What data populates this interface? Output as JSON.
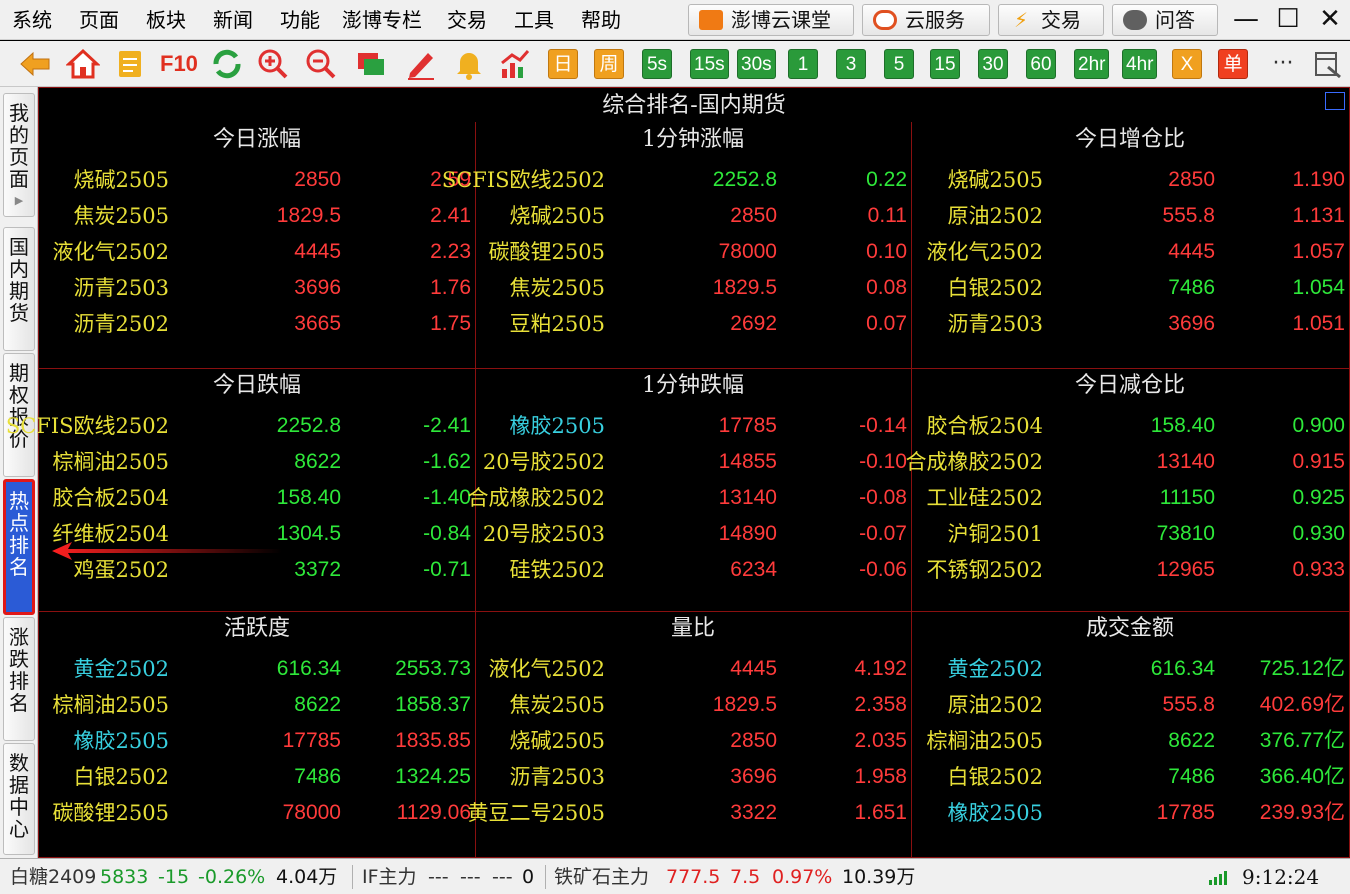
{
  "menu": [
    "系统",
    "页面",
    "板块",
    "新闻",
    "功能",
    "澎博专栏",
    "交易",
    "工具",
    "帮助"
  ],
  "top_buttons": [
    {
      "label": "澎博云课堂",
      "icon": "classroom-icon",
      "color": "#f07a14"
    },
    {
      "label": "云服务",
      "icon": "cloud-icon",
      "color": "#e05020"
    },
    {
      "label": "交易",
      "icon": "lightning-icon",
      "color": "#f0a010"
    },
    {
      "label": "问答",
      "icon": "chat-bubble-icon",
      "color": "#606060"
    }
  ],
  "window_controls": {
    "minimize": "—",
    "maximize": "☐",
    "close": "✕"
  },
  "toolbar": {
    "icons": [
      "back-arrow-icon",
      "home-icon",
      "notes-icon",
      "f10-icon",
      "refresh-icon",
      "zoom-in-icon",
      "zoom-out-icon",
      "window-icon",
      "pen-icon",
      "bell-icon",
      "chart-up-icon"
    ],
    "f10_label": "F10",
    "timeframes": [
      {
        "label": "日",
        "style": "orange"
      },
      {
        "label": "周",
        "style": "orange"
      },
      {
        "label": "5s",
        "style": "green"
      },
      {
        "label": "15s",
        "style": "green"
      },
      {
        "label": "30s",
        "style": "green"
      },
      {
        "label": "1",
        "style": "green"
      },
      {
        "label": "3",
        "style": "green"
      },
      {
        "label": "5",
        "style": "green"
      },
      {
        "label": "15",
        "style": "green"
      },
      {
        "label": "30",
        "style": "green"
      },
      {
        "label": "60",
        "style": "green"
      },
      {
        "label": "2hr",
        "style": "green"
      },
      {
        "label": "4hr",
        "style": "green"
      },
      {
        "label": "X",
        "style": "orange"
      },
      {
        "label": "单",
        "style": "red"
      }
    ],
    "more": "···"
  },
  "side_tabs": [
    {
      "label": "我的页面",
      "active": false,
      "has_arrow": true
    },
    {
      "label": "国内期货",
      "active": false,
      "has_arrow": false
    },
    {
      "label": "期权报价",
      "active": false,
      "has_arrow": false
    },
    {
      "label": "热点排名",
      "active": true,
      "has_arrow": false
    },
    {
      "label": "涨跌排名",
      "active": false,
      "has_arrow": false
    },
    {
      "label": "数据中心",
      "active": false,
      "has_arrow": false
    }
  ],
  "main_title": "综合排名-国内期货",
  "panels": [
    {
      "title": "今日涨幅",
      "rows": [
        {
          "name": "烧碱2505",
          "nc": "yellow",
          "price": "2850",
          "pc": "red",
          "value": "2.59",
          "vc": "red"
        },
        {
          "name": "焦炭2505",
          "nc": "yellow",
          "price": "1829.5",
          "pc": "red",
          "value": "2.41",
          "vc": "red"
        },
        {
          "name": "液化气2502",
          "nc": "yellow",
          "price": "4445",
          "pc": "red",
          "value": "2.23",
          "vc": "red"
        },
        {
          "name": "沥青2503",
          "nc": "yellow",
          "price": "3696",
          "pc": "red",
          "value": "1.76",
          "vc": "red"
        },
        {
          "name": "沥青2502",
          "nc": "yellow",
          "price": "3665",
          "pc": "red",
          "value": "1.75",
          "vc": "red"
        }
      ]
    },
    {
      "title": "1分钟涨幅",
      "rows": [
        {
          "name": "SCFIS欧线2502",
          "nc": "yellow",
          "price": "2252.8",
          "pc": "green",
          "value": "0.22",
          "vc": "green"
        },
        {
          "name": "烧碱2505",
          "nc": "yellow",
          "price": "2850",
          "pc": "red",
          "value": "0.11",
          "vc": "red"
        },
        {
          "name": "碳酸锂2505",
          "nc": "yellow",
          "price": "78000",
          "pc": "red",
          "value": "0.10",
          "vc": "red"
        },
        {
          "name": "焦炭2505",
          "nc": "yellow",
          "price": "1829.5",
          "pc": "red",
          "value": "0.08",
          "vc": "red"
        },
        {
          "name": "豆粕2505",
          "nc": "yellow",
          "price": "2692",
          "pc": "red",
          "value": "0.07",
          "vc": "red"
        }
      ]
    },
    {
      "title": "今日增仓比",
      "rows": [
        {
          "name": "烧碱2505",
          "nc": "yellow",
          "price": "2850",
          "pc": "red",
          "value": "1.190",
          "vc": "red"
        },
        {
          "name": "原油2502",
          "nc": "yellow",
          "price": "555.8",
          "pc": "red",
          "value": "1.131",
          "vc": "red"
        },
        {
          "name": "液化气2502",
          "nc": "yellow",
          "price": "4445",
          "pc": "red",
          "value": "1.057",
          "vc": "red"
        },
        {
          "name": "白银2502",
          "nc": "yellow",
          "price": "7486",
          "pc": "green",
          "value": "1.054",
          "vc": "green"
        },
        {
          "name": "沥青2503",
          "nc": "yellow",
          "price": "3696",
          "pc": "red",
          "value": "1.051",
          "vc": "red"
        }
      ]
    },
    {
      "title": "今日跌幅",
      "rows": [
        {
          "name": "SCFIS欧线2502",
          "nc": "yellow",
          "price": "2252.8",
          "pc": "green",
          "value": "-2.41",
          "vc": "green"
        },
        {
          "name": "棕榈油2505",
          "nc": "yellow",
          "price": "8622",
          "pc": "green",
          "value": "-1.62",
          "vc": "green"
        },
        {
          "name": "胶合板2504",
          "nc": "yellow",
          "price": "158.40",
          "pc": "green",
          "value": "-1.40",
          "vc": "green"
        },
        {
          "name": "纤维板2504",
          "nc": "yellow",
          "price": "1304.5",
          "pc": "green",
          "value": "-0.84",
          "vc": "green"
        },
        {
          "name": "鸡蛋2502",
          "nc": "yellow",
          "price": "3372",
          "pc": "green",
          "value": "-0.71",
          "vc": "green"
        }
      ]
    },
    {
      "title": "1分钟跌幅",
      "rows": [
        {
          "name": "橡胶2505",
          "nc": "cyan",
          "price": "17785",
          "pc": "red",
          "value": "-0.14",
          "vc": "red"
        },
        {
          "name": "20号胶2502",
          "nc": "yellow",
          "price": "14855",
          "pc": "red",
          "value": "-0.10",
          "vc": "red"
        },
        {
          "name": "合成橡胶2502",
          "nc": "yellow",
          "price": "13140",
          "pc": "red",
          "value": "-0.08",
          "vc": "red"
        },
        {
          "name": "20号胶2503",
          "nc": "yellow",
          "price": "14890",
          "pc": "red",
          "value": "-0.07",
          "vc": "red"
        },
        {
          "name": "硅铁2502",
          "nc": "yellow",
          "price": "6234",
          "pc": "red",
          "value": "-0.06",
          "vc": "red"
        }
      ]
    },
    {
      "title": "今日减仓比",
      "rows": [
        {
          "name": "胶合板2504",
          "nc": "yellow",
          "price": "158.40",
          "pc": "green",
          "value": "0.900",
          "vc": "green"
        },
        {
          "name": "合成橡胶2502",
          "nc": "yellow",
          "price": "13140",
          "pc": "red",
          "value": "0.915",
          "vc": "red"
        },
        {
          "name": "工业硅2502",
          "nc": "yellow",
          "price": "11150",
          "pc": "green",
          "value": "0.925",
          "vc": "green"
        },
        {
          "name": "沪铜2501",
          "nc": "yellow",
          "price": "73810",
          "pc": "green",
          "value": "0.930",
          "vc": "green"
        },
        {
          "name": "不锈钢2502",
          "nc": "yellow",
          "price": "12965",
          "pc": "red",
          "value": "0.933",
          "vc": "red"
        }
      ]
    },
    {
      "title": "活跃度",
      "rows": [
        {
          "name": "黄金2502",
          "nc": "cyan",
          "price": "616.34",
          "pc": "green",
          "value": "2553.73",
          "vc": "green"
        },
        {
          "name": "棕榈油2505",
          "nc": "yellow",
          "price": "8622",
          "pc": "green",
          "value": "1858.37",
          "vc": "green"
        },
        {
          "name": "橡胶2505",
          "nc": "cyan",
          "price": "17785",
          "pc": "red",
          "value": "1835.85",
          "vc": "red"
        },
        {
          "name": "白银2502",
          "nc": "yellow",
          "price": "7486",
          "pc": "green",
          "value": "1324.25",
          "vc": "green"
        },
        {
          "name": "碳酸锂2505",
          "nc": "yellow",
          "price": "78000",
          "pc": "red",
          "value": "1129.06",
          "vc": "red"
        }
      ]
    },
    {
      "title": "量比",
      "rows": [
        {
          "name": "液化气2502",
          "nc": "yellow",
          "price": "4445",
          "pc": "red",
          "value": "4.192",
          "vc": "red"
        },
        {
          "name": "焦炭2505",
          "nc": "yellow",
          "price": "1829.5",
          "pc": "red",
          "value": "2.358",
          "vc": "red"
        },
        {
          "name": "烧碱2505",
          "nc": "yellow",
          "price": "2850",
          "pc": "red",
          "value": "2.035",
          "vc": "red"
        },
        {
          "name": "沥青2503",
          "nc": "yellow",
          "price": "3696",
          "pc": "red",
          "value": "1.958",
          "vc": "red"
        },
        {
          "name": "黄豆二号2505",
          "nc": "yellow",
          "price": "3322",
          "pc": "red",
          "value": "1.651",
          "vc": "red"
        }
      ]
    },
    {
      "title": "成交金额",
      "rows": [
        {
          "name": "黄金2502",
          "nc": "cyan",
          "price": "616.34",
          "pc": "green",
          "value": "725.12亿",
          "vc": "green"
        },
        {
          "name": "原油2502",
          "nc": "yellow",
          "price": "555.8",
          "pc": "red",
          "value": "402.69亿",
          "vc": "red"
        },
        {
          "name": "棕榈油2505",
          "nc": "yellow",
          "price": "8622",
          "pc": "green",
          "value": "376.77亿",
          "vc": "green"
        },
        {
          "name": "白银2502",
          "nc": "yellow",
          "price": "7486",
          "pc": "green",
          "value": "366.40亿",
          "vc": "green"
        },
        {
          "name": "橡胶2505",
          "nc": "cyan",
          "price": "17785",
          "pc": "red",
          "value": "239.93亿",
          "vc": "red"
        }
      ]
    }
  ],
  "status": {
    "item1": {
      "name": "白糖2409",
      "price": "5833",
      "change": "-15",
      "pct": "-0.26%",
      "volume": "4.04万"
    },
    "item2": {
      "name": "IF主力",
      "price": "---",
      "change": "---",
      "pct": "---",
      "volume": "0"
    },
    "item3": {
      "name": "铁矿石主力",
      "price": "777.5",
      "change": "7.5",
      "pct": "0.97%",
      "volume": "10.39万"
    },
    "signal_icon": "signal-icon",
    "time": "9:12:24"
  },
  "colors": {
    "accent_red": "#ff3b3b",
    "accent_green": "#2ee83a",
    "name_yellow": "#e8e038",
    "name_cyan": "#38d0e0",
    "active_tab": "#2b5bd6",
    "grid_line": "#8a1010"
  }
}
